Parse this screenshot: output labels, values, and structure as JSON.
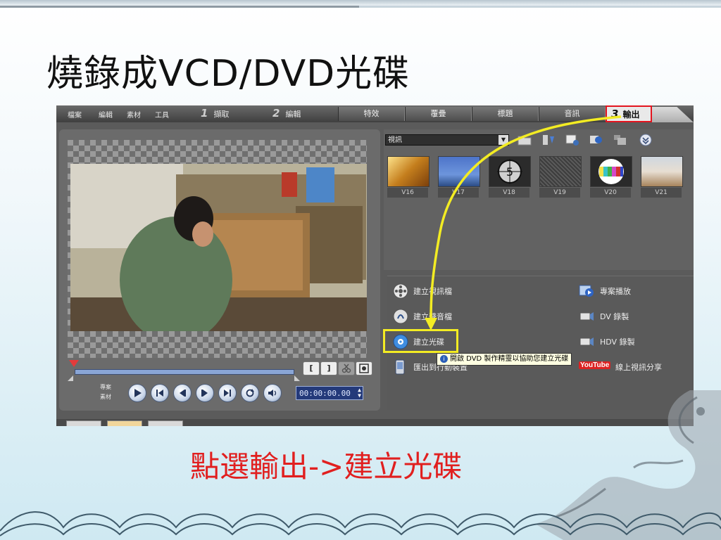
{
  "slide": {
    "title": "燒錄成VCD/DVD光碟",
    "caption": "點選輸出->建立光碟"
  },
  "menu": {
    "items": [
      "檔案",
      "編輯",
      "素材",
      "工具"
    ],
    "steps": [
      {
        "num": "1",
        "label": "擷取"
      },
      {
        "num": "2",
        "label": "編輯"
      }
    ],
    "tabs": [
      "特效",
      "覆疊",
      "標題",
      "音訊"
    ],
    "output_tab": {
      "num": "3",
      "label": "輸出"
    }
  },
  "preview": {
    "project_label": "專案",
    "clip_label": "素材",
    "timecode": "00:00:00.00",
    "trim_in": "[",
    "trim_out": "]"
  },
  "library": {
    "selected_category": "視訊",
    "thumbnails": [
      "V16",
      "V17",
      "V18",
      "V19",
      "V20",
      "V21"
    ]
  },
  "tasks": {
    "left": [
      "建立視訊檔",
      "建立聲音檔",
      "建立光碟",
      "匯出到行動裝置"
    ],
    "right": [
      "專案播放",
      "DV 錄製",
      "HDV 錄製",
      "線上視訊分享"
    ],
    "youtube_logo": "YouTube",
    "tooltip": "開啟 DVD 製作精靈以協助您建立光碟"
  },
  "colors": {
    "highlight": "#f3ec23",
    "output_tab_border": "#e3141e",
    "caption": "#e11f1f"
  }
}
